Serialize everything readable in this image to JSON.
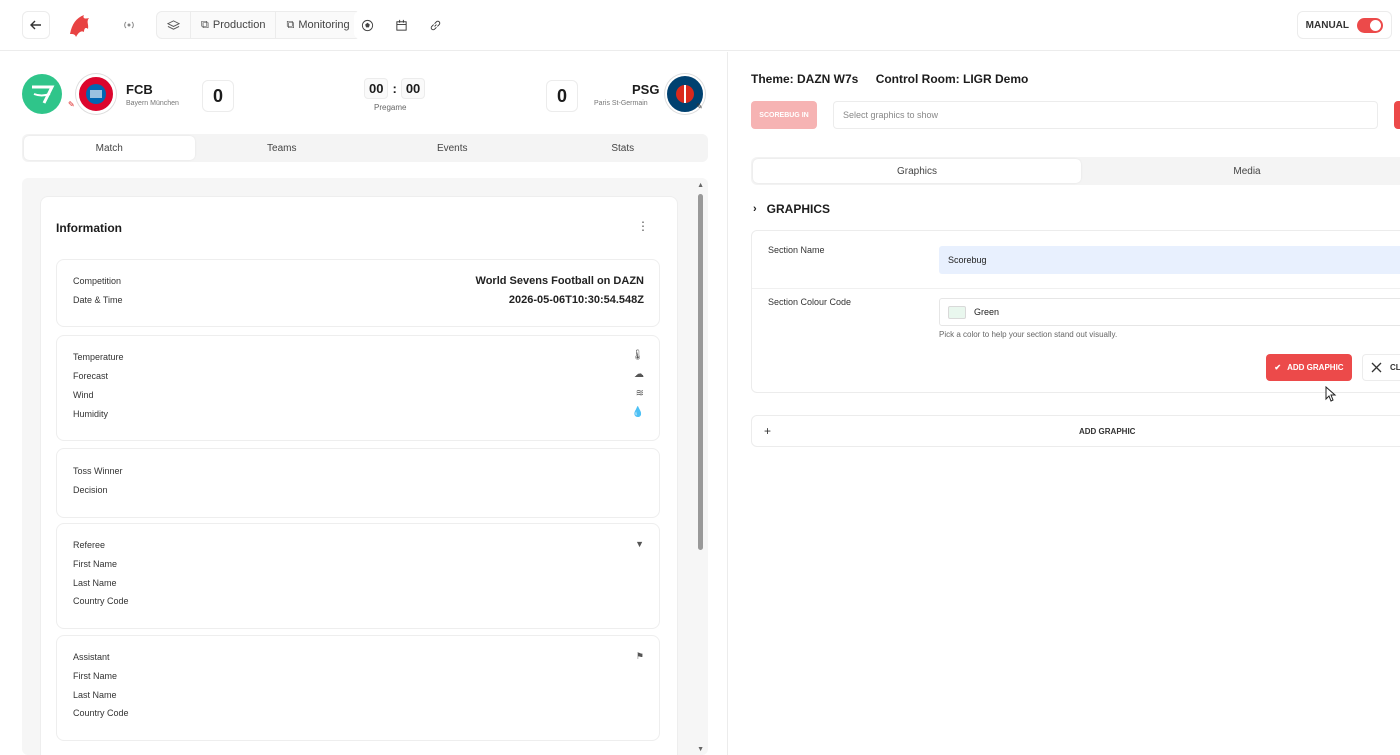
{
  "topbar": {
    "production_label": "Production",
    "monitoring_label": "Monitoring",
    "manual_label": "MANUAL",
    "accent": "#ec4a4a"
  },
  "match": {
    "home": {
      "code": "FCB",
      "name": "Bayern München",
      "score": "0"
    },
    "away": {
      "code": "PSG",
      "name": "Paris St-Germain",
      "score": "0"
    },
    "clock_min": "00",
    "clock_sep": ":",
    "clock_sec": "00",
    "status": "Pregame"
  },
  "left_tabs": [
    "Match",
    "Teams",
    "Events",
    "Stats"
  ],
  "information": {
    "title": "Information",
    "competition_label": "Competition",
    "competition_value": "World Sevens Football on DAZN",
    "datetime_label": "Date & Time",
    "datetime_value": "2026-05-06T10:30:54.548Z",
    "weather": [
      "Temperature",
      "Forecast",
      "Wind",
      "Humidity"
    ],
    "toss_winner_label": "Toss Winner",
    "decision_label": "Decision",
    "referee_label": "Referee",
    "referee_fields": [
      "First Name",
      "Last Name",
      "Country Code"
    ],
    "assistant_label": "Assistant",
    "assistant_fields": [
      "First Name",
      "Last Name",
      "Country Code"
    ]
  },
  "right": {
    "theme_text": "Theme: DAZN W7s",
    "control_room_text": "Control Room: LIGR Demo",
    "scorebug_in_label": "SCOREBUG IN",
    "select_placeholder": "Select graphics to show",
    "tabs": [
      "Graphics",
      "Media"
    ],
    "graphics_heading": "GRAPHICS",
    "section_name_label": "Section Name",
    "section_name_value": "Scorebug",
    "section_colour_label": "Section Colour Code",
    "section_colour_value": "Green",
    "section_colour_hex": "#e9f7ee",
    "helper_text": "Pick a color to help your section stand out visually.",
    "add_graphic_button": "ADD GRAPHIC",
    "close_button": "CLO",
    "add_graphic_bar": "ADD GRAPHIC"
  }
}
